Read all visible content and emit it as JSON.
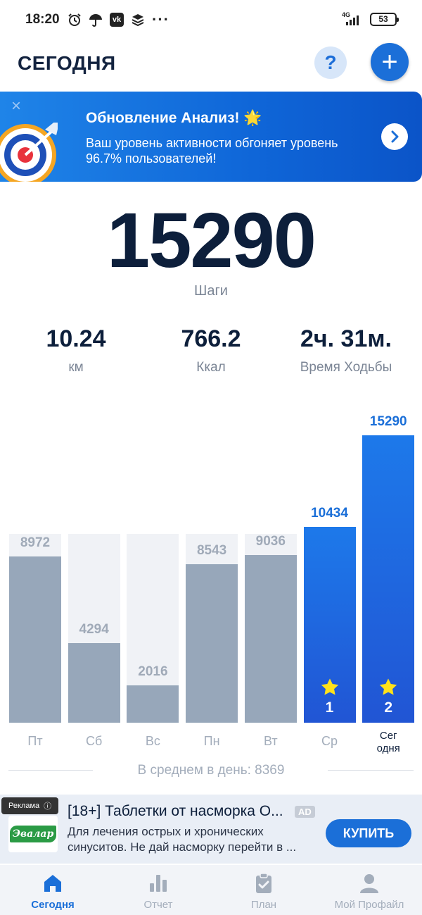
{
  "status_bar": {
    "time": "18:20",
    "network": "4G",
    "battery": "53",
    "icons": [
      "alarm-icon",
      "umbrella-icon",
      "vk-icon",
      "layers-icon",
      "more-dots-icon"
    ]
  },
  "header": {
    "title": "СЕГОДНЯ",
    "help_label": "?",
    "add_label": "+"
  },
  "banner": {
    "title": "Обновление Анализ! 🌟",
    "text": "Ваш уровень активности обгоняет уровень 96.7% пользователей!",
    "close_label": "×"
  },
  "steps": {
    "value": "15290",
    "label": "Шаги"
  },
  "metrics": [
    {
      "value": "10.24",
      "unit": "км"
    },
    {
      "value": "766.2",
      "unit": "Ккал"
    },
    {
      "value": "2ч. 31м.",
      "unit": "Время Ходьбы"
    }
  ],
  "chart_data": {
    "type": "bar",
    "categories": [
      "Пт",
      "Сб",
      "Вс",
      "Пн",
      "Вт",
      "Ср",
      "Сег\nодня"
    ],
    "values": [
      8972,
      4294,
      2016,
      8543,
      9036,
      10434,
      15290
    ],
    "labels": [
      "8972",
      "4294",
      "2016",
      "8543",
      "9036",
      "10434",
      "15290"
    ],
    "active": [
      false,
      false,
      false,
      false,
      false,
      true,
      true
    ],
    "stars": [
      null,
      null,
      null,
      null,
      null,
      "1",
      "2"
    ],
    "colors": {
      "inactive": "#97a7ba",
      "active": "#1b6fd8",
      "track": "#f0f2f6"
    }
  },
  "average": {
    "text": "В среднем в день: 8369"
  },
  "ad": {
    "badge": "Реклама",
    "brand": "Эвалар",
    "title": "[18+] Таблетки от насморка О...",
    "tag": "AD",
    "description": "Для лечения острых и хронических синуситов. Не дай насморку перейти в ...",
    "cta": "КУПИТЬ"
  },
  "bottom_nav": [
    {
      "label": "Сегодня",
      "icon": "home-icon",
      "active": true
    },
    {
      "label": "Отчет",
      "icon": "bar-chart-icon",
      "active": false
    },
    {
      "label": "План",
      "icon": "clipboard-icon",
      "active": false
    },
    {
      "label": "Мой Профайл",
      "icon": "profile-icon",
      "active": false
    }
  ]
}
